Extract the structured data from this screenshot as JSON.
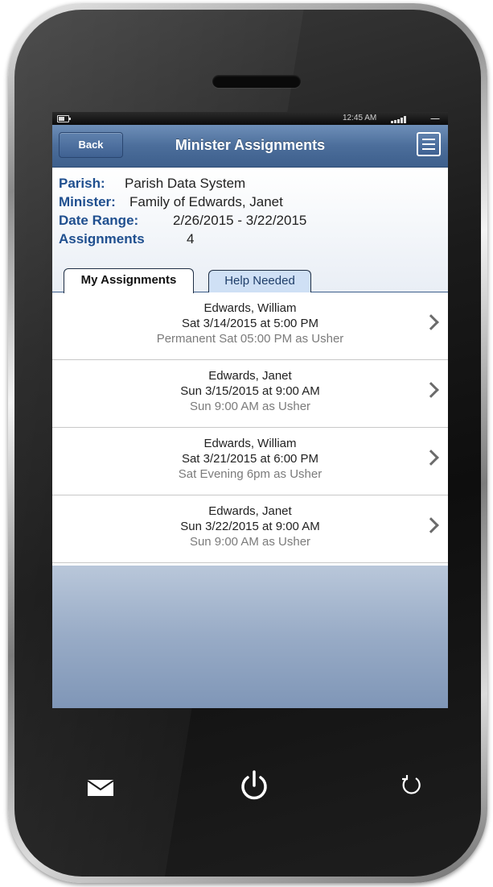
{
  "status_bar": {
    "time": "12:45 AM"
  },
  "header": {
    "back_label": "Back",
    "title": "Minister Assignments"
  },
  "info": {
    "parish_label": "Parish:",
    "parish_value": "Parish Data System",
    "minister_label": "Minister:",
    "minister_value": "Family of Edwards, Janet",
    "date_range_label": "Date Range:",
    "date_range_value": "2/26/2015 - 3/22/2015",
    "assignments_label": "Assignments",
    "assignments_value": "4"
  },
  "tabs": [
    {
      "label": "My Assignments",
      "active": true
    },
    {
      "label": "Help Needed",
      "active": false
    }
  ],
  "assignments": [
    {
      "name": "Edwards, William",
      "date": "Sat 3/14/2015 at 5:00 PM",
      "detail": "Permanent Sat 05:00 PM as Usher"
    },
    {
      "name": "Edwards, Janet",
      "date": "Sun 3/15/2015 at 9:00 AM",
      "detail": "Sun 9:00 AM as Usher"
    },
    {
      "name": "Edwards, William",
      "date": "Sat 3/21/2015 at 6:00 PM",
      "detail": "Sat Evening 6pm as Usher"
    },
    {
      "name": "Edwards, Janet",
      "date": "Sun 3/22/2015 at 9:00 AM",
      "detail": "Sun 9:00 AM as Usher"
    }
  ],
  "icons": {
    "menu": "menu-icon",
    "chevron": "chevron-right-icon",
    "mail": "mail-icon",
    "power": "power-icon",
    "back": "back-arrow-icon"
  },
  "colors": {
    "header_blue": "#4c6e9b",
    "label_blue": "#1f4f8f",
    "tab_inactive": "#cfe0f5"
  }
}
